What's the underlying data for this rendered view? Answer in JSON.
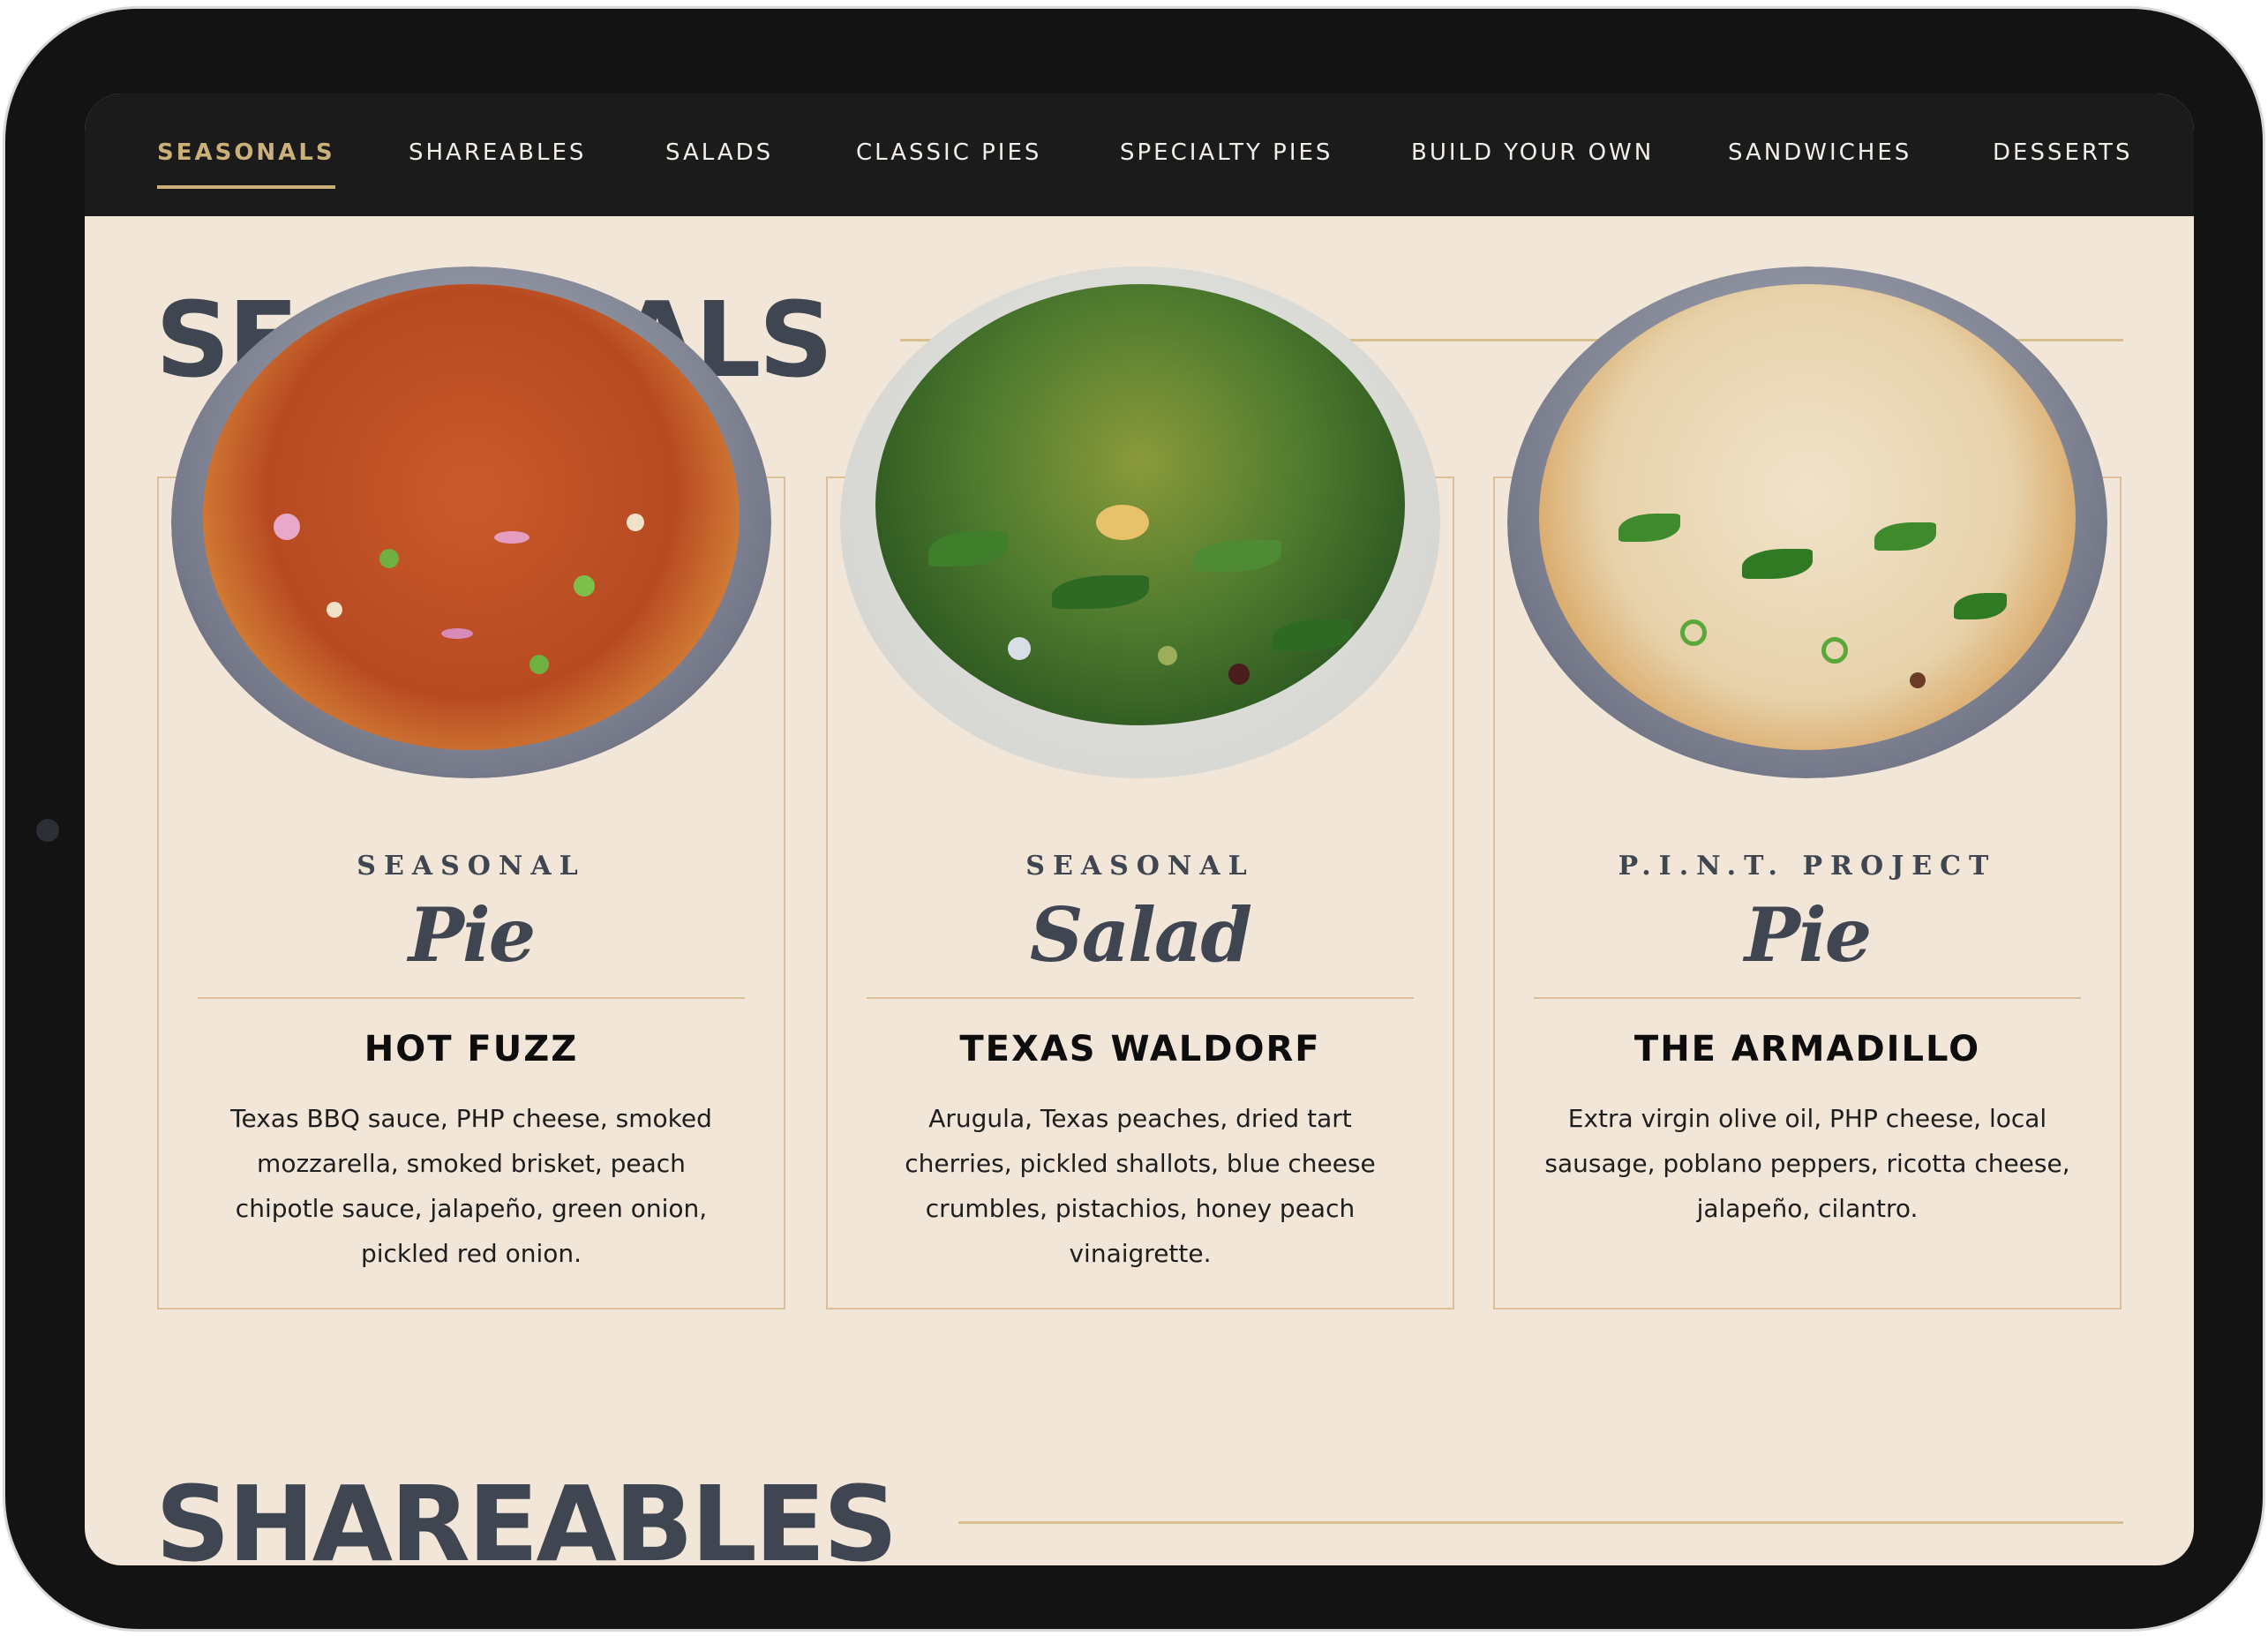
{
  "nav": {
    "items": [
      {
        "label": "SEASONALS",
        "active": true
      },
      {
        "label": "SHAREABLES"
      },
      {
        "label": "SALADS"
      },
      {
        "label": "CLASSIC PIES"
      },
      {
        "label": "SPECIALTY PIES"
      },
      {
        "label": "BUILD YOUR OWN"
      },
      {
        "label": "SANDWICHES"
      },
      {
        "label": "DESSERTS"
      }
    ]
  },
  "sections": [
    {
      "title": "SEASONALS"
    },
    {
      "title": "SHAREABLES"
    }
  ],
  "cards": [
    {
      "label_top": "SEASONAL",
      "label_script": "Pie",
      "name": "HOT FUZZ",
      "description": "Texas BBQ sauce, PHP cheese, smoked mozzarella, smoked brisket, peach chipotle sauce, jalapeño, green onion, pickled red onion.",
      "image": "pizza-image"
    },
    {
      "label_top": "SEASONAL",
      "label_script": "Salad",
      "name": "TEXAS WALDORF",
      "description": "Arugula, Texas peaches, dried tart cherries, pickled shallots, blue cheese crumbles, pistachios, honey peach vinaigrette.",
      "image": "salad-image"
    },
    {
      "label_top": "P.I.N.T. PROJECT",
      "label_script": "Pie",
      "name": "THE ARMADILLO",
      "description": "Extra virgin olive oil, PHP cheese, local sausage, poblano peppers, ricotta cheese, jalapeño, cilantro.",
      "image": "pizza-image"
    }
  ],
  "colors": {
    "nav_bg": "#1b1b1b",
    "accent": "#ccb079",
    "page_bg": "#f1e6d7",
    "title": "#3f4652"
  }
}
